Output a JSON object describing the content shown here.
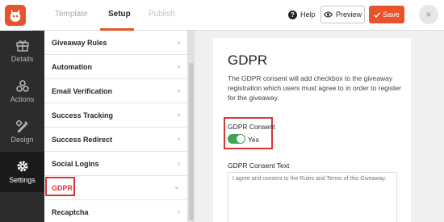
{
  "topbar": {
    "tabs": [
      {
        "label": "Template"
      },
      {
        "label": "Setup"
      },
      {
        "label": "Publish"
      }
    ],
    "help_label": "Help",
    "preview_label": "Preview",
    "save_label": "Save",
    "close_symbol": "×",
    "accent_color": "#e8532b"
  },
  "leftnav": {
    "items": [
      {
        "label": "Details",
        "icon": "gift-icon"
      },
      {
        "label": "Actions",
        "icon": "actions-icon"
      },
      {
        "label": "Design",
        "icon": "design-icon"
      },
      {
        "label": "Settings",
        "icon": "gear-icon",
        "active": true
      }
    ]
  },
  "settings_list": {
    "items": [
      {
        "label": "Giveaway Rules"
      },
      {
        "label": "Automation"
      },
      {
        "label": "Email Verification"
      },
      {
        "label": "Success Tracking"
      },
      {
        "label": "Success Redirect"
      },
      {
        "label": "Social Logins"
      },
      {
        "label": "GDPR",
        "active": true
      },
      {
        "label": "Recaptcha"
      }
    ]
  },
  "gdpr_panel": {
    "title": "GDPR",
    "description": "The GDPR consent will add checkbox to the giveaway registration which users must agree to in order to register for the giveaway.",
    "consent_label": "GDPR Consent",
    "consent_toggle_text": "Yes",
    "consent_on": true,
    "consent_text_label": "GDPR Consent Text",
    "consent_text_placeholder": "I agree and consent to the Rules and Terms of this Giveaway."
  },
  "colors": {
    "highlight_red": "#d63638",
    "toggle_green": "#3aa655",
    "nav_dark": "#2c2c2c"
  }
}
